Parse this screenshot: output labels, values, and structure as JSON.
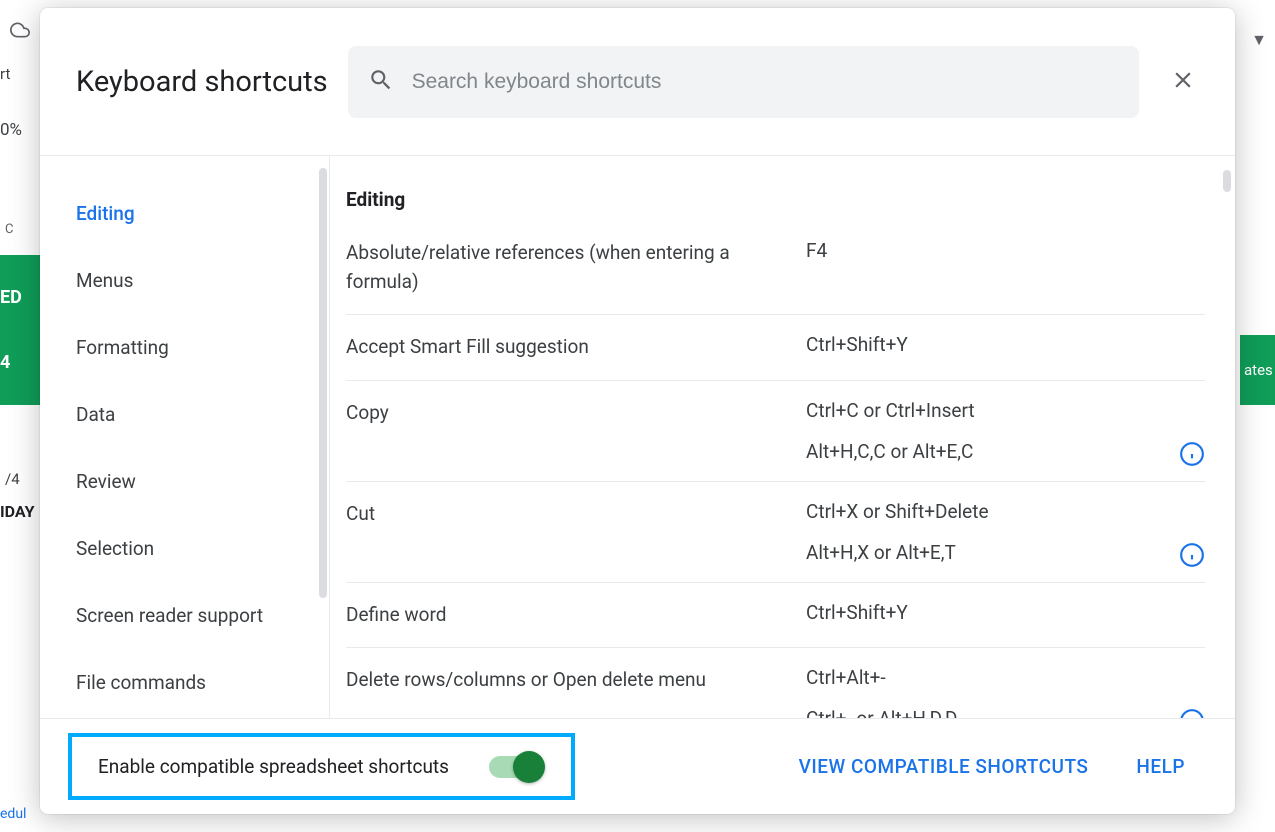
{
  "background": {
    "rt": "rt",
    "zoom": "0%",
    "cell_c": "C",
    "green1": "ED",
    "green2": "4",
    "right_green": "ates",
    "date": "/4",
    "day": "IDAY",
    "bottom": "edul"
  },
  "dialog": {
    "title": "Keyboard shortcuts",
    "search_placeholder": "Search keyboard shortcuts"
  },
  "sidebar": {
    "items": [
      {
        "label": "Editing",
        "active": true
      },
      {
        "label": "Menus",
        "active": false
      },
      {
        "label": "Formatting",
        "active": false
      },
      {
        "label": "Data",
        "active": false
      },
      {
        "label": "Review",
        "active": false
      },
      {
        "label": "Selection",
        "active": false
      },
      {
        "label": "Screen reader support",
        "active": false
      },
      {
        "label": "File commands",
        "active": false
      }
    ]
  },
  "content": {
    "section": "Editing",
    "rows": [
      {
        "desc": "Absolute/relative references (when entering a formula)",
        "keys": [
          "F4"
        ],
        "info": false
      },
      {
        "desc": "Accept Smart Fill suggestion",
        "keys": [
          "Ctrl+Shift+Y"
        ],
        "info": false
      },
      {
        "desc": "Copy",
        "keys": [
          "Ctrl+C or Ctrl+Insert",
          "Alt+H,C,C or Alt+E,C"
        ],
        "info": true
      },
      {
        "desc": "Cut",
        "keys": [
          "Ctrl+X or Shift+Delete",
          "Alt+H,X or Alt+E,T"
        ],
        "info": true
      },
      {
        "desc": "Define word",
        "keys": [
          "Ctrl+Shift+Y"
        ],
        "info": false
      },
      {
        "desc": "Delete rows/columns or Open delete menu",
        "keys": [
          "Ctrl+Alt+-",
          "Ctrl+- or Alt+H,D,D"
        ],
        "info": true
      }
    ]
  },
  "footer": {
    "toggle_label": "Enable compatible spreadsheet shortcuts",
    "toggle_on": true,
    "view_compat": "VIEW COMPATIBLE SHORTCUTS",
    "help": "HELP"
  }
}
